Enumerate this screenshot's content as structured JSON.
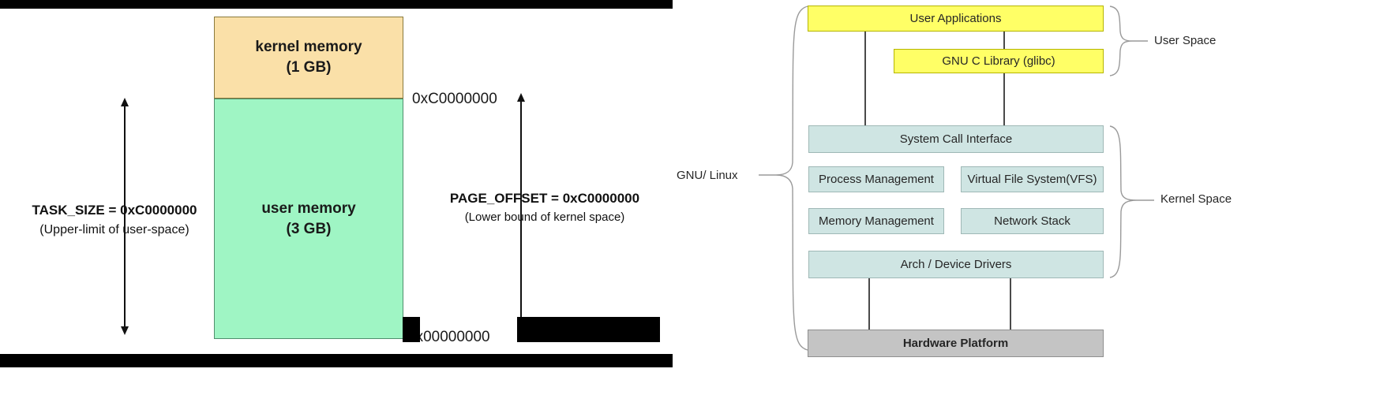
{
  "left_diagram": {
    "title": "linux-virtual-memory-split",
    "kernel_box": {
      "line1": "kernel memory",
      "line2": "(1 GB)",
      "color": "#fae0a8"
    },
    "user_box": {
      "line1": "user memory",
      "line2": "(3 GB)",
      "color": "#9ff5c4"
    },
    "addresses": {
      "top": "0xC0000000",
      "bottom": "0x00000000"
    },
    "task_size": {
      "main": "TASK_SIZE = 0xC0000000",
      "sub": "(Upper-limit of user-space)"
    },
    "page_offset": {
      "main": "PAGE_OFFSET = 0xC0000000",
      "sub": "(Lower bound of kernel space)"
    }
  },
  "right_diagram": {
    "title": "gnu-linux-architecture-stack",
    "nodes": {
      "user_applications": "User Applications",
      "glibc": "GNU C Library (glibc)",
      "system_call_interface": "System Call Interface",
      "process_management": "Process Management",
      "virtual_file_system": "Virtual File System(VFS)",
      "memory_management": "Memory Management",
      "network_stack": "Network Stack",
      "arch_device_drivers": "Arch / Device Drivers",
      "hardware_platform": "Hardware Platform"
    },
    "labels": {
      "user_space": "User Space",
      "kernel_space": "Kernel Space",
      "gnu_linux": "GNU/ Linux"
    },
    "colors": {
      "user_space_fill": "#ffff66",
      "kernel_space_fill": "#cfe5e3",
      "hardware_fill": "#c4c4c4"
    }
  }
}
